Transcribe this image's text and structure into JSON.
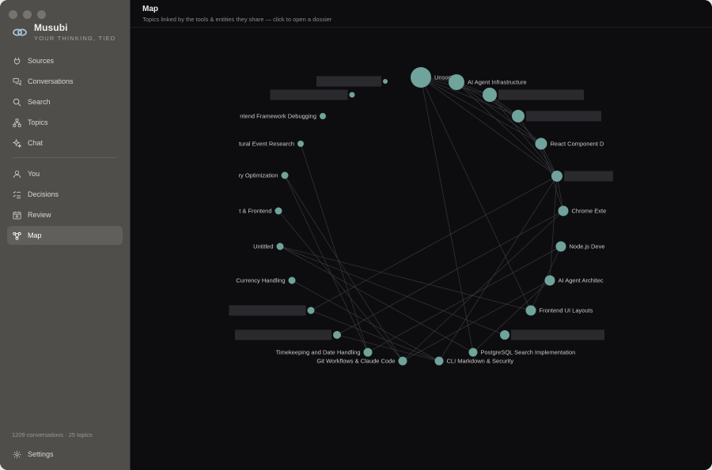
{
  "app": {
    "name": "Musubi",
    "tagline": "YOUR THINKING, TIED"
  },
  "sidebar": {
    "items": [
      {
        "label": "Sources",
        "icon": "plug-icon"
      },
      {
        "label": "Conversations",
        "icon": "chat-bubbles-icon"
      },
      {
        "label": "Search",
        "icon": "search-icon"
      },
      {
        "label": "Topics",
        "icon": "topics-icon"
      },
      {
        "label": "Chat",
        "icon": "sparkle-icon"
      }
    ],
    "items2": [
      {
        "label": "You",
        "icon": "user-icon"
      },
      {
        "label": "Decisions",
        "icon": "checklist-icon"
      },
      {
        "label": "Review",
        "icon": "calendar-icon"
      },
      {
        "label": "Map",
        "icon": "graph-icon",
        "active": true
      }
    ],
    "footer_count": "1209 conversations · 25 topics",
    "settings_label": "Settings"
  },
  "header": {
    "title": "Map",
    "subtitle": "Topics linked by the tools & entities they share — click to open a dossier"
  },
  "colors": {
    "node": "#6fa39b",
    "edge": "#3a3a40",
    "sidebar": "#4f4e4b",
    "background": "#0d0d0f"
  },
  "map": {
    "nodes": [
      {
        "id": "unsorted",
        "label": "Unsorted"
      },
      {
        "id": "ai-agent-infra",
        "label": "AI Agent Infrastructure"
      },
      {
        "id": "r3",
        "label": ""
      },
      {
        "id": "r4",
        "label": ""
      },
      {
        "id": "react-component",
        "label": "React Component D"
      },
      {
        "id": "r6",
        "label": ""
      },
      {
        "id": "chrome-ext",
        "label": "Chrome Exte"
      },
      {
        "id": "nodejs-dev",
        "label": "Node.js Deve"
      },
      {
        "id": "ai-agent-arch",
        "label": "AI Agent Architec"
      },
      {
        "id": "frontend-ui",
        "label": "Frontend UI Layouts"
      },
      {
        "id": "r11",
        "label": ""
      },
      {
        "id": "postgres-search",
        "label": "PostgreSQL Search Implementation"
      },
      {
        "id": "cli-markdown",
        "label": "CLI Markdown & Security"
      },
      {
        "id": "git-workflows",
        "label": "Git Workflows & Claude Code"
      },
      {
        "id": "timekeeping",
        "label": "Timekeeping and Date Handling"
      },
      {
        "id": "r16",
        "label": ""
      },
      {
        "id": "r17",
        "label": ""
      },
      {
        "id": "currency",
        "label": "Currency Handling"
      },
      {
        "id": "untitled",
        "label": "Untitled"
      },
      {
        "id": "frontend",
        "label": "t & Frontend"
      },
      {
        "id": "query-opt",
        "label": "ry Optimization"
      },
      {
        "id": "cultural-event",
        "label": "tural Event Research"
      },
      {
        "id": "frontend-debug",
        "label": "ntend Framework Debugging"
      },
      {
        "id": "r24",
        "label": ""
      },
      {
        "id": "r25",
        "label": ""
      }
    ]
  }
}
